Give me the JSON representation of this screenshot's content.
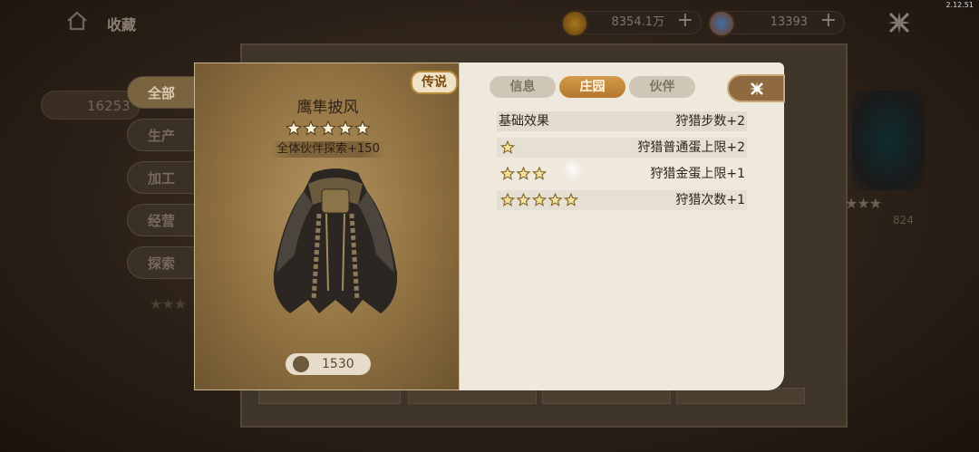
{
  "version": "2.12.51",
  "background": {
    "title": "收藏",
    "gold_count": "8354.1万",
    "gem_count": "13393",
    "plus": "+",
    "side_value": "16253",
    "side_tabs": [
      {
        "label": "全部",
        "active": true
      },
      {
        "label": "生产",
        "active": false
      },
      {
        "label": "加工",
        "active": false
      },
      {
        "label": "经营",
        "active": false
      },
      {
        "label": "探索",
        "active": false
      }
    ],
    "right_number": "824"
  },
  "item": {
    "rarity_badge": "传说",
    "name": "鹰隼披风",
    "stars": 5,
    "bonus": "全体伙伴探索+150",
    "price": "1530"
  },
  "tabs": [
    {
      "label": "信息",
      "active": false
    },
    {
      "label": "庄园",
      "active": true
    },
    {
      "label": "伙伴",
      "active": false
    }
  ],
  "effects": {
    "base": {
      "label": "基础效果",
      "effect": "狩猎步数+2"
    },
    "tiers": [
      {
        "stars": 1,
        "effect": "狩猎普通蛋上限+2"
      },
      {
        "stars": 3,
        "effect": "狩猎金蛋上限+1"
      },
      {
        "stars": 5,
        "effect": "狩猎次数+1"
      }
    ]
  },
  "colors": {
    "accent": "#b4782e",
    "star": "#f3e3a0"
  },
  "icons": [
    "home-icon",
    "gold-coin-icon",
    "gem-icon",
    "close-icon",
    "star-icon",
    "cloak-image",
    "coin-icon"
  ]
}
